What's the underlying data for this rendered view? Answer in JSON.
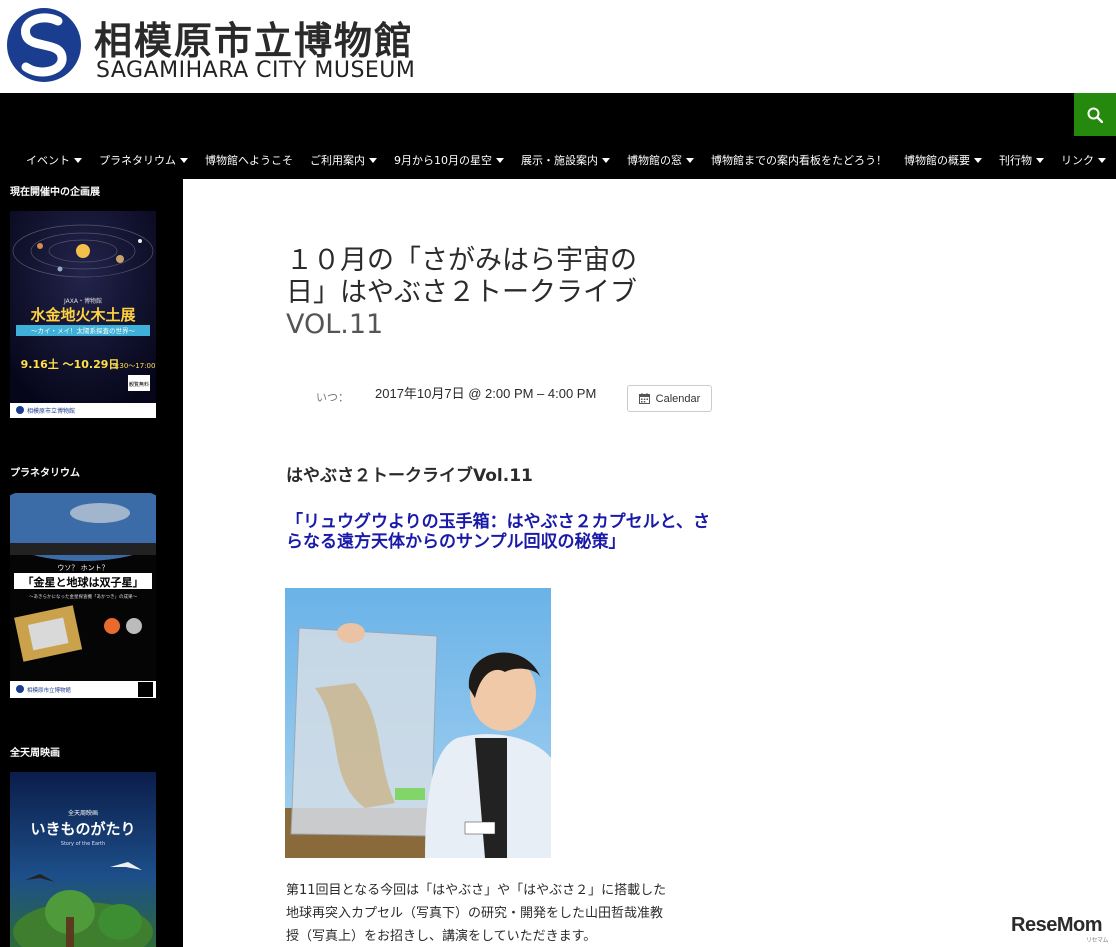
{
  "header": {
    "title_jp": "相模原市立博物館",
    "title_en": "SAGAMIHARA CITY MUSEUM"
  },
  "nav": {
    "items": [
      {
        "label": "イベント",
        "dropdown": true
      },
      {
        "label": "プラネタリウム",
        "dropdown": true
      },
      {
        "label": "博物館へようこそ",
        "dropdown": false
      },
      {
        "label": "ご利用案内",
        "dropdown": true
      },
      {
        "label": "9月から10月の星空",
        "dropdown": true
      },
      {
        "label": "展示・施設案内",
        "dropdown": true
      },
      {
        "label": "博物館の窓",
        "dropdown": true
      },
      {
        "label": "博物館までの案内看板をたどろう！",
        "dropdown": false
      },
      {
        "label": "博物館の概要",
        "dropdown": true
      },
      {
        "label": "刊行物",
        "dropdown": true
      },
      {
        "label": "リンク",
        "dropdown": true
      }
    ],
    "search_icon": "search-icon",
    "accent": "#24890d"
  },
  "sidebar": {
    "widget1_title": "現在開催中の企画展",
    "poster1": {
      "badge": "JAXA・博物館",
      "title": "水金地火木土展",
      "subtitle": "〜カイ・メイ！太陽系探査の世界〜",
      "dates": "9.16土 〜10.29日",
      "time": "9:30〜17:00",
      "fee": "観覧無料",
      "footer": "相模原市立博物館"
    },
    "widget2_title": "プラネタリウム",
    "poster2": {
      "tagline": "ウソ？ ホント？",
      "title": "「金星と地球は双子星」",
      "subtitle": "〜あきらかになった金星探査機「あかつき」の成果〜",
      "footer": "相模原市立博物館"
    },
    "widget3_title": "全天周映画",
    "poster3": {
      "label": "全天周映画",
      "title": "いきものがたり",
      "subtitle": "Story of the Earth"
    }
  },
  "main": {
    "title_line1": "１０月の「さがみはら宇宙の",
    "title_line2": "日」はやぶさ２トークライブ",
    "title_line3": "VOL.11",
    "when_label": "いつ：",
    "when_value": "2017年10月7日 @ 2:00 PM – 4:00 PM",
    "calendar_label": "Calendar",
    "subheading": "はやぶさ２トークライブVol.11",
    "link_heading": "「リュウグウよりの玉手箱：はやぶさ２カプセルと、さらなる遠方天体からのサンプル回収の秘策」",
    "body_line1": "第11回目となる今回は「はやぶさ」や「はやぶさ２」に搭載した",
    "body_line2": "地球再突入カプセル（写真下）の研究・開発をした山田哲哉准教",
    "body_line3": "授（写真上）をお招きし、講演をしていただきます。"
  },
  "watermark": {
    "text": "ReseMom",
    "small": "リセマム"
  }
}
